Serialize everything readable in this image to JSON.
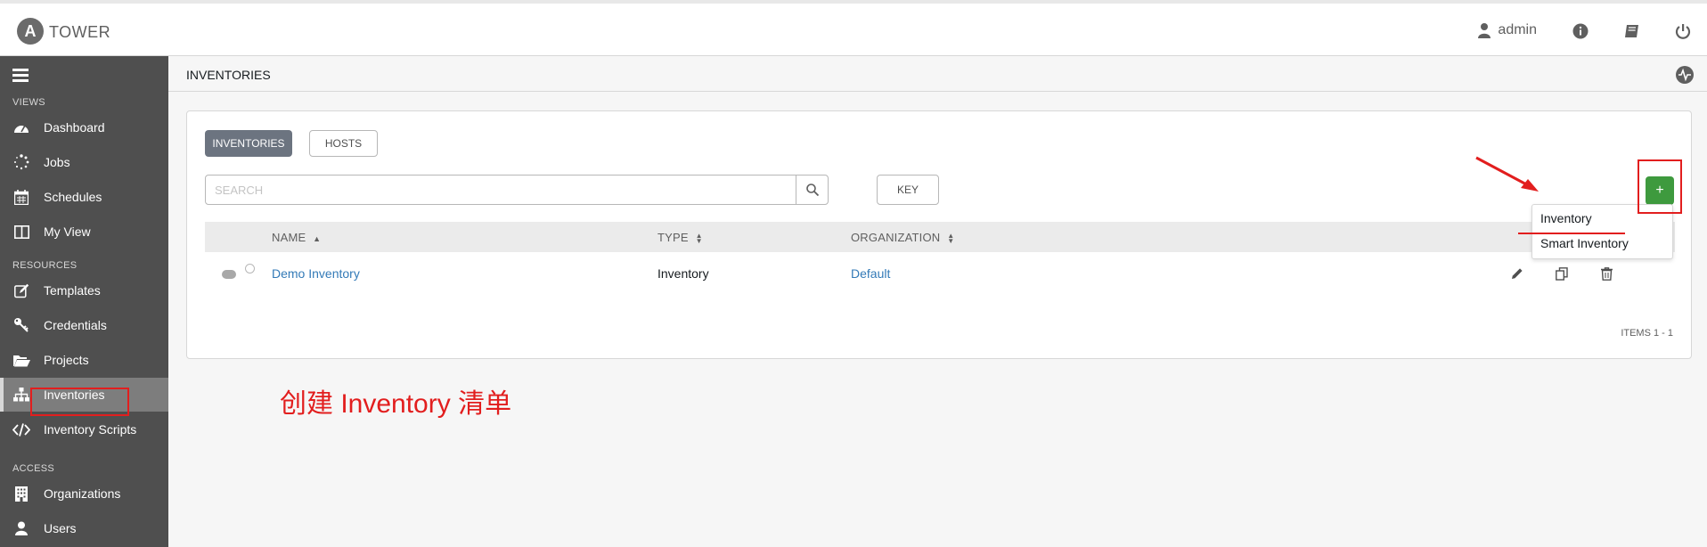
{
  "header": {
    "brand": "TOWER",
    "logo_letter": "A",
    "user": "admin",
    "icons": [
      "user-icon",
      "info-icon",
      "book-icon",
      "power-icon"
    ]
  },
  "sidebar": {
    "sections": [
      {
        "title": "VIEWS",
        "items": [
          {
            "label": "Dashboard",
            "icon": "dashboard-icon"
          },
          {
            "label": "Jobs",
            "icon": "spinner-icon"
          },
          {
            "label": "Schedules",
            "icon": "calendar-icon"
          },
          {
            "label": "My View",
            "icon": "columns-icon"
          }
        ]
      },
      {
        "title": "RESOURCES",
        "items": [
          {
            "label": "Templates",
            "icon": "pencil-square-icon"
          },
          {
            "label": "Credentials",
            "icon": "key-icon"
          },
          {
            "label": "Projects",
            "icon": "folder-open-icon"
          },
          {
            "label": "Inventories",
            "icon": "sitemap-icon",
            "active": true
          },
          {
            "label": "Inventory Scripts",
            "icon": "code-icon"
          }
        ]
      },
      {
        "title": "ACCESS",
        "items": [
          {
            "label": "Organizations",
            "icon": "building-icon"
          },
          {
            "label": "Users",
            "icon": "user-icon"
          }
        ]
      }
    ]
  },
  "breadcrumb": "INVENTORIES",
  "tabs": {
    "inventories": "INVENTORIES",
    "hosts": "HOSTS"
  },
  "search": {
    "placeholder": "SEARCH",
    "value": ""
  },
  "key_button": "KEY",
  "add_button": "+",
  "table": {
    "columns": [
      {
        "label": "NAME",
        "sort": "asc"
      },
      {
        "label": "TYPE",
        "sort": "both"
      },
      {
        "label": "ORGANIZATION",
        "sort": "both"
      }
    ],
    "rows": [
      {
        "name": "Demo Inventory",
        "type": "Inventory",
        "organization": "Default"
      }
    ]
  },
  "add_menu": [
    "Inventory",
    "Smart Inventory"
  ],
  "item_count": "ITEMS  1 - 1",
  "annotation": "创建 Inventory 清单",
  "colors": {
    "accent_red": "#e21e1e",
    "add_green": "#3e9a3e",
    "link_blue": "#337ab7",
    "sidebar_bg": "#4f4f4f"
  }
}
